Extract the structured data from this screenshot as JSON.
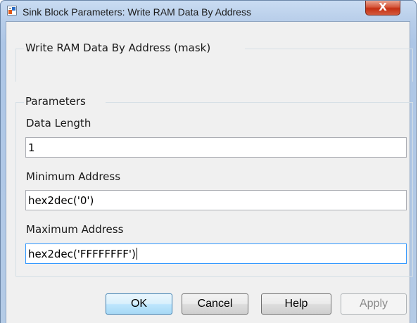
{
  "window": {
    "title": "Sink Block Parameters: Write RAM Data By Address",
    "close_glyph": "X"
  },
  "description_group": {
    "title": "Write RAM Data By Address (mask)"
  },
  "parameters_group": {
    "title": "Parameters",
    "fields": [
      {
        "label": "Data Length",
        "value": "1"
      },
      {
        "label": "Minimum Address",
        "value": "hex2dec('0')"
      },
      {
        "label": "Maximum Address",
        "value": "hex2dec('FFFFFFFF')"
      }
    ]
  },
  "buttons": {
    "ok": "OK",
    "cancel": "Cancel",
    "help": "Help",
    "apply": "Apply"
  },
  "colors": {
    "close_button": "#c42f12",
    "focus_border": "#3399ff",
    "default_button": "#3c7fb1"
  },
  "icons": [
    "simulink-block-icon",
    "close-icon"
  ]
}
